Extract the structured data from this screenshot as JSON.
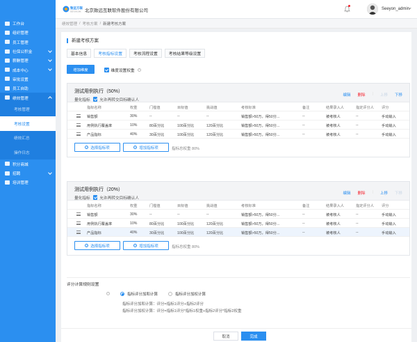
{
  "sidebar": {
    "items": [
      {
        "label": "工作台"
      },
      {
        "label": "组织管理"
      },
      {
        "label": "员工管理"
      },
      {
        "label": "社保公积金"
      },
      {
        "label": "薪酬管理"
      },
      {
        "label": "成本中心"
      },
      {
        "label": "审批设置"
      },
      {
        "label": "员工自助"
      },
      {
        "label": "绩效管理"
      }
    ],
    "sub_items": [
      {
        "label": "考核管理"
      },
      {
        "label": "考核设置"
      },
      {
        "label": "绩效汇总"
      },
      {
        "label": "操作日志"
      }
    ],
    "after_items": [
      {
        "label": "积分商城"
      },
      {
        "label": "招聘"
      },
      {
        "label": "培训管理"
      }
    ]
  },
  "topbar": {
    "logo_cn": "致远方联",
    "logo_en": "SEEYON LINK",
    "company": "北京致远互联软件股份有限公司",
    "username": "Seeyon_admin"
  },
  "breadcrumb": [
    "绩效管理",
    "考核方案",
    "新建考核方案"
  ],
  "page": {
    "title": "新建考核方案",
    "tabs": [
      "基本信息",
      "考核指标设置",
      "考核流程设置",
      "考核结果等级设置"
    ],
    "add_dimension": "增加维度",
    "weight_setting": "维度设置权重"
  },
  "table_headers": [
    "指标名称",
    "权重",
    "门槛值",
    "目标值",
    "挑战值",
    "考核标准",
    "备注",
    "结果录入人",
    "指定评分人",
    "评分"
  ],
  "actions": {
    "edit": "编辑",
    "delete": "删除",
    "up": "上移",
    "down": "下移"
  },
  "groups": [
    {
      "title": "测试用例执行（50%）",
      "quant_label": "量化指标",
      "allow_label": "允许再转交目标确认人",
      "rows": [
        [
          "销售额",
          "30%",
          "--",
          "--",
          "--",
          "销售额>50万，得50分...",
          "--",
          "被考核人",
          "--",
          "手动输入"
        ],
        [
          "用例执行覆盖率",
          "10%",
          "80百分比",
          "100百分比",
          "120百分比",
          "销售额>50万，得50分...",
          "--",
          "被考核人",
          "--",
          "手动输入"
        ],
        [
          "产品指标",
          "40%",
          "30百分比",
          "100百分比",
          "120百分比",
          "销售额>50万，得50分...",
          "--",
          "被考核人",
          "--",
          "手动输入"
        ]
      ],
      "choose_btn": "选择指标项",
      "add_btn": "增加指标项",
      "total": "指标总权重 80%"
    },
    {
      "title": "测试用例执行（20%）",
      "quant_label": "量化指标",
      "allow_label": "允许再转交目标确认人",
      "rows": [
        [
          "销售额",
          "30%",
          "--",
          "--",
          "--",
          "销售额>50万，得50分...",
          "--",
          "被考核人",
          "--",
          "手动输入"
        ],
        [
          "用例执行覆盖率",
          "10%",
          "80百分比",
          "100百分比",
          "120百分比",
          "销售额>50万，得50分...",
          "--",
          "被考核人",
          "--",
          "手动输入"
        ],
        [
          "产品指标",
          "40%",
          "30百分比",
          "100百分比",
          "120百分比",
          "销售额>50万，得50分...",
          "--",
          "被考核人",
          "--",
          "手动输入"
        ]
      ],
      "choose_btn": "选择指标项",
      "add_btn": "增加指标项",
      "total": "指标总权重 80%"
    }
  ],
  "rule": {
    "title": "评分计算规则设置",
    "opt1": "指标评分加和计算",
    "opt2": "指标评分加权计算",
    "formula1": "指标评分加和计算：评分=指标1评分+指标2评分",
    "formula2": "指标评分加权计算：评分=指标1评分*指标1权重+指标2评分*指标2权重"
  },
  "footer": {
    "cancel": "取消",
    "done": "完成"
  },
  "colors": {
    "primary": "#2b8ff0",
    "danger": "#f5222d"
  }
}
